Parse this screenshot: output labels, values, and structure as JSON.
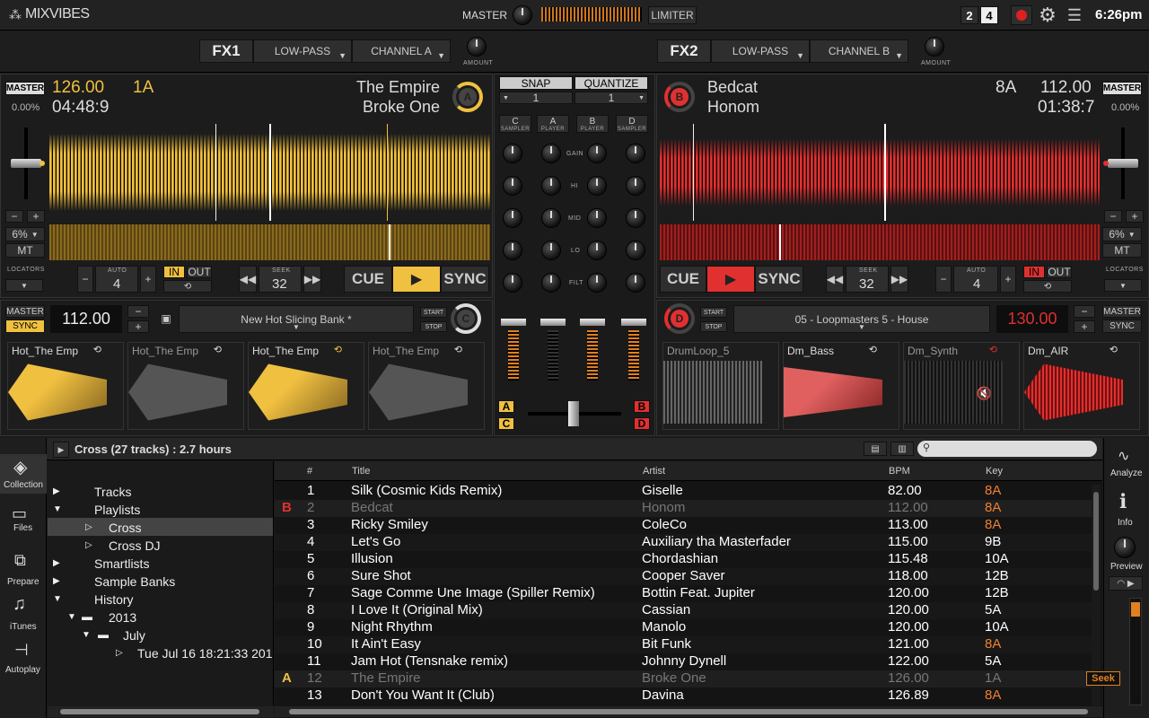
{
  "app": {
    "logo": "MIXVIBES",
    "master_label": "MASTER",
    "limiter_label": "LIMITER",
    "deck_mode_2": "2",
    "deck_mode_4": "4",
    "clock": "6:26pm"
  },
  "fx": [
    {
      "label": "FX1",
      "effect": "LOW-PASS",
      "channel": "CHANNEL A",
      "amount_label": "AMOUNT"
    },
    {
      "label": "FX2",
      "effect": "LOW-PASS",
      "channel": "CHANNEL B",
      "amount_label": "AMOUNT"
    }
  ],
  "deckA": {
    "letter": "A",
    "master_label": "MASTER",
    "bpm": "126.00",
    "key": "1A",
    "pitch": "0.00%",
    "time": "04:48:9",
    "title": "The Empire",
    "artist": "Broke One",
    "range": "6%",
    "mt": "MT",
    "locators": "LOCATORS",
    "auto_label": "AUTO",
    "auto_value": "4",
    "in_label": "IN",
    "out_label": "OUT",
    "seek_label": "SEEK",
    "seek_value": "32",
    "cue": "CUE",
    "sync": "SYNC",
    "minus": "−",
    "plus": "+",
    "color": "#f0c040"
  },
  "deckB": {
    "letter": "B",
    "master_label": "MASTER",
    "bpm": "112.00",
    "key": "8A",
    "pitch": "0.00%",
    "time": "01:38:7",
    "title": "Bedcat",
    "artist": "Honom",
    "range": "6%",
    "mt": "MT",
    "locators": "LOCATORS",
    "auto_label": "AUTO",
    "auto_value": "4",
    "in_label": "IN",
    "out_label": "OUT",
    "seek_label": "SEEK",
    "seek_value": "32",
    "cue": "CUE",
    "sync": "SYNC",
    "minus": "−",
    "plus": "+",
    "color": "#e03030"
  },
  "mixer": {
    "snap": "SNAP",
    "quantize": "QUANTIZE",
    "snap_value": "1",
    "quantize_value": "1",
    "channels": [
      {
        "letter": "C",
        "sub": "SAMPLER"
      },
      {
        "letter": "A",
        "sub": "PLAYER"
      },
      {
        "letter": "B",
        "sub": "PLAYER"
      },
      {
        "letter": "D",
        "sub": "SAMPLER"
      }
    ],
    "eq": [
      "GAIN",
      "HI",
      "MID",
      "LO",
      "FILT"
    ],
    "xfade_a": "A",
    "xfade_b": "B",
    "xfade_c": "C",
    "xfade_d": "D"
  },
  "samplerC": {
    "letter": "C",
    "master_label": "MASTER",
    "sync": "SYNC",
    "bpm": "112.00",
    "bank": "New Hot Slicing Bank *",
    "start": "START",
    "stop": "STOP",
    "minus": "−",
    "plus": "+",
    "slots": [
      "Hot_The Emp",
      "Hot_The Emp",
      "Hot_The Emp",
      "Hot_The Emp"
    ]
  },
  "samplerD": {
    "letter": "D",
    "master_label": "MASTER",
    "sync": "SYNC",
    "bpm": "130.00",
    "bank": "05 - Loopmasters 5 - House",
    "start": "START",
    "stop": "STOP",
    "minus": "−",
    "plus": "+",
    "slots": [
      "DrumLoop_5",
      "Dm_Bass",
      "Dm_Synth",
      "Dm_AIR"
    ]
  },
  "browser": {
    "header": "Cross (27 tracks) : 2.7 hours",
    "sidebar": [
      "Collection",
      "Files",
      "Prepare",
      "iTunes",
      "Autoplay"
    ],
    "tree": [
      "Tracks",
      "Playlists",
      "Cross",
      "Cross DJ",
      "Smartlists",
      "Sample Banks",
      "History",
      "2013",
      "July",
      "Tue Jul 16 18:21:33 201"
    ],
    "columns": [
      "#",
      "Title",
      "Artist",
      "BPM",
      "Key"
    ],
    "rows": [
      {
        "deck": "",
        "num": "1",
        "title": "Silk (Cosmic Kids Remix)",
        "artist": "Giselle",
        "bpm": "82.00",
        "key": "8A"
      },
      {
        "deck": "B",
        "num": "2",
        "title": "Bedcat",
        "artist": "Honom",
        "bpm": "112.00",
        "key": "8A"
      },
      {
        "deck": "",
        "num": "3",
        "title": "Ricky Smiley",
        "artist": "ColeCo",
        "bpm": "113.00",
        "key": "8A"
      },
      {
        "deck": "",
        "num": "4",
        "title": "Let's Go",
        "artist": "Auxiliary tha Masterfader",
        "bpm": "115.00",
        "key": "9B"
      },
      {
        "deck": "",
        "num": "5",
        "title": "Illusion",
        "artist": "Chordashian",
        "bpm": "115.48",
        "key": "10A"
      },
      {
        "deck": "",
        "num": "6",
        "title": "Sure Shot",
        "artist": "Cooper Saver",
        "bpm": "118.00",
        "key": "12B"
      },
      {
        "deck": "",
        "num": "7",
        "title": "Sage Comme Une Image (Spiller Remix)",
        "artist": "Bottin Feat. Jupiter",
        "bpm": "120.00",
        "key": "12B"
      },
      {
        "deck": "",
        "num": "8",
        "title": "I Love It (Original Mix)",
        "artist": "Cassian",
        "bpm": "120.00",
        "key": "5A"
      },
      {
        "deck": "",
        "num": "9",
        "title": "Night Rhythm",
        "artist": "Manolo",
        "bpm": "120.00",
        "key": "10A"
      },
      {
        "deck": "",
        "num": "10",
        "title": "It Ain't Easy",
        "artist": "Bit Funk",
        "bpm": "121.00",
        "key": "8A"
      },
      {
        "deck": "",
        "num": "11",
        "title": "Jam Hot (Tensnake remix)",
        "artist": "Johnny Dynell",
        "bpm": "122.00",
        "key": "5A"
      },
      {
        "deck": "A",
        "num": "12",
        "title": "The Empire",
        "artist": "Broke One",
        "bpm": "126.00",
        "key": "1A"
      },
      {
        "deck": "",
        "num": "13",
        "title": "Don't You Want It (Club)",
        "artist": "Davina",
        "bpm": "126.89",
        "key": "8A"
      }
    ],
    "right_tools": [
      "Analyze",
      "Info",
      "Preview"
    ],
    "seek_tooltip": "Seek"
  }
}
